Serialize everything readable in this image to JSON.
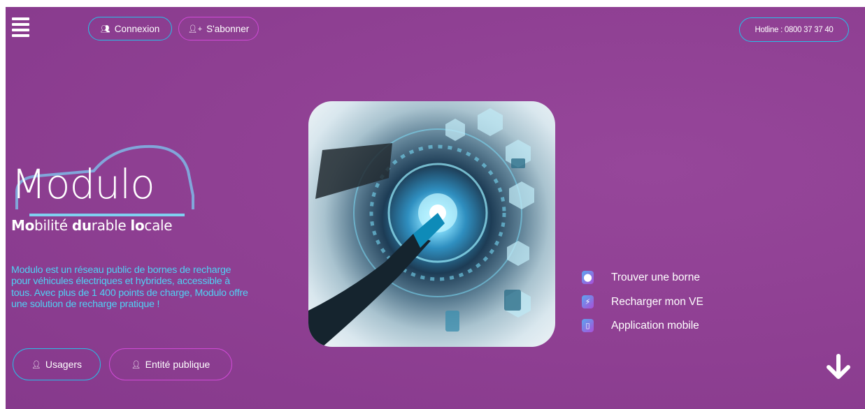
{
  "header": {
    "login_label": "Connexion",
    "subscribe_label": "S'abonner",
    "hotline_label": "Hotline : 0800 37 37 40"
  },
  "brand": {
    "logo_text": "Modulo",
    "tagline_parts": [
      "Mo",
      "bilité ",
      "du",
      "rable ",
      "lo",
      "cale"
    ]
  },
  "intro": {
    "description": "Modulo est un réseau public de bornes de recharge pour véhicules électriques et hybrides, accessible à tous. Avec plus de 1 400 points de charge, Modulo offre une solution de recharge pratique !"
  },
  "audience": {
    "users_label": "Usagers",
    "public_entity_label": "Entité publique"
  },
  "quick_links": [
    {
      "label": "Trouver une borne",
      "icon": "map-pin-icon"
    },
    {
      "label": "Recharger mon VE",
      "icon": "charging-icon"
    },
    {
      "label": "Application mobile",
      "icon": "phone-icon"
    }
  ],
  "colors": {
    "background": "#8e3f92",
    "accent_cyan": "#27c0e8",
    "accent_magenta": "#d04bd6",
    "description_text": "#4fd2f5"
  }
}
